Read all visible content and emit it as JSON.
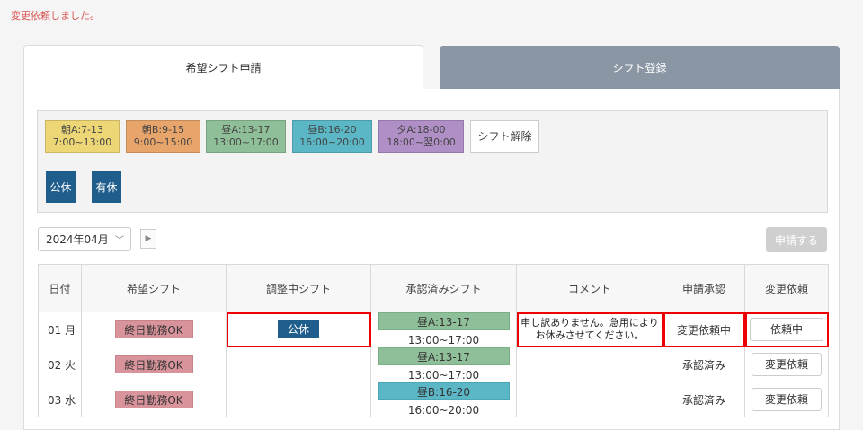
{
  "flash_message": "変更依頼しました。",
  "tabs": [
    {
      "label": "希望シフト申請",
      "active": true
    },
    {
      "label": "シフト登録",
      "active": false
    }
  ],
  "shift_palette": [
    {
      "name": "朝A:7-13",
      "time": "7:00~13:00",
      "color": "#ecd676"
    },
    {
      "name": "朝B:9-15",
      "time": "9:00~15:00",
      "color": "#e8a56b"
    },
    {
      "name": "昼A:13-17",
      "time": "13:00~17:00",
      "color": "#8fbf98"
    },
    {
      "name": "昼B:16-20",
      "time": "16:00~20:00",
      "color": "#5bb7c5"
    },
    {
      "name": "夕A:18-00",
      "time": "18:00~翌0:00",
      "color": "#b08fc6"
    }
  ],
  "shift_clear_label": "シフト解除",
  "leave_types": [
    "公休",
    "有休"
  ],
  "month_select": {
    "value": "2024年04月"
  },
  "submit_label": "申請する",
  "table": {
    "headers": [
      "日付",
      "希望シフト",
      "調整中シフト",
      "承認済みシフト",
      "コメント",
      "申請承認",
      "変更依頼"
    ],
    "rows": [
      {
        "date": "01 月",
        "wish": "終日勤務OK",
        "adjusting": "公休",
        "approved": "昼A:13-17 13:00~17:00",
        "comment_line1": "申し訳ありません。急用により",
        "comment_line2": "お休みさせてください。",
        "status": "変更依頼中",
        "action": "依頼中"
      },
      {
        "date": "02 火",
        "wish": "終日勤務OK",
        "adjusting": "",
        "approved": "昼A:13-17 13:00~17:00",
        "comment_line1": "",
        "comment_line2": "",
        "status": "承認済み",
        "action": "変更依頼"
      },
      {
        "date": "03 水",
        "wish": "終日勤務OK",
        "adjusting": "",
        "approved": "昼B:16-20 16:00~20:00",
        "comment_line1": "",
        "comment_line2": "",
        "status": "承認済み",
        "action": "変更依頼"
      }
    ]
  }
}
